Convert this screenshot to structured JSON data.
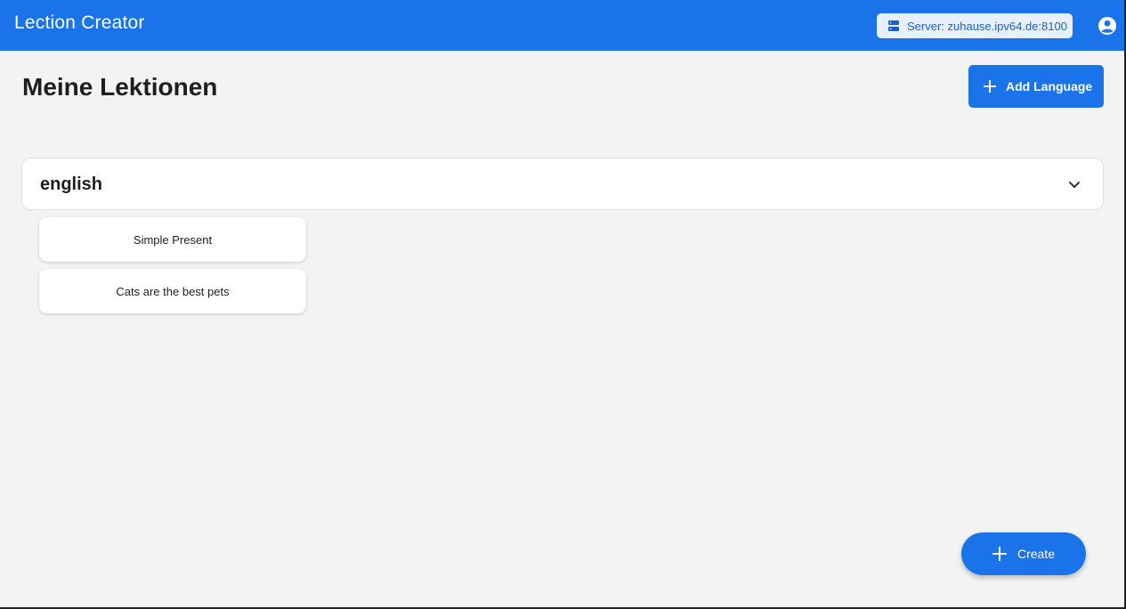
{
  "app": {
    "title": "Lection Creator",
    "server_label": "Server: zuhause.ipv64.de:8100"
  },
  "header": {
    "page_title": "Meine Lektionen",
    "add_language_label": "Add Language"
  },
  "languages": [
    {
      "name": "english",
      "expanded": true,
      "lessons": [
        {
          "label": "Simple Present"
        },
        {
          "label": "Cats are the best pets"
        }
      ]
    }
  ],
  "fab": {
    "label": "Create"
  },
  "colors": {
    "primary": "#1a73e8",
    "background": "#f3f3f3",
    "chip_background": "#e7f0fe"
  },
  "icons": {
    "server": "server-icon",
    "account": "account-circle-icon",
    "add": "plus-icon",
    "expand": "chevron-down-icon"
  }
}
